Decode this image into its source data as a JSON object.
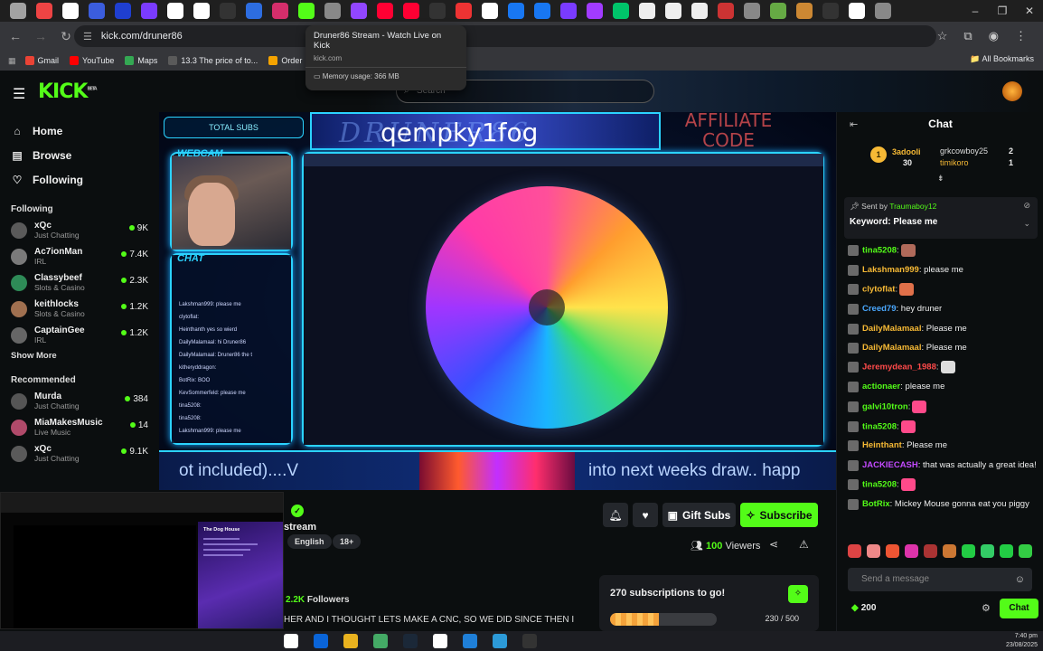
{
  "browser": {
    "tab_icon_colors": [
      "#a2a2a2",
      "#e44",
      "#fff",
      "#3b5ddd",
      "#1f3fd0",
      "#7a3bff",
      "#fff",
      "#fff",
      "#333",
      "#2d6de0",
      "#d42e6b",
      "#53fc18",
      "#888",
      "#9146ff",
      "#f03",
      "#f03",
      "#333",
      "#e33",
      "#fff",
      "#1877f2",
      "#1877f2",
      "#7a3bff",
      "#a23bff",
      "#00c46a",
      "#eee",
      "#eee",
      "#eee",
      "#c33",
      "#888",
      "#6a4",
      "#c83",
      "#333",
      "#fff",
      "#888"
    ],
    "url": "kick.com/druner86",
    "window_controls": [
      "–",
      "❐",
      "✕"
    ]
  },
  "bookmarks": [
    {
      "label": "Gmail",
      "color": "#ea4335"
    },
    {
      "label": "YouTube",
      "color": "#ff0000"
    },
    {
      "label": "Maps",
      "color": "#34a853"
    },
    {
      "label": "13.3 The price of to...",
      "color": "#5a5a5a"
    },
    {
      "label": "Order",
      "color": "#f4a300"
    }
  ],
  "bookmarks_all": "All Bookmarks",
  "tooltip": {
    "title": "Druner86 Stream - Watch Live on Kick",
    "domain": "kick.com",
    "memory": "Memory usage: 366 MB"
  },
  "kick": {
    "logo": "KICK",
    "logo_badge": "BETA",
    "search_placeholder": "Search"
  },
  "sidebar": {
    "nav": [
      {
        "label": "Home",
        "icon": "home-icon",
        "glyph": "⌂"
      },
      {
        "label": "Browse",
        "icon": "browse-icon",
        "glyph": "▤"
      },
      {
        "label": "Following",
        "icon": "heart-icon",
        "glyph": "♡"
      }
    ],
    "following_title": "Following",
    "following": [
      {
        "name": "xQc",
        "category": "Just Chatting",
        "viewers": "9K",
        "color": "#5a5a5a"
      },
      {
        "name": "Ac7ionMan",
        "category": "IRL",
        "viewers": "7.4K",
        "color": "#7a7a7a"
      },
      {
        "name": "Classybeef",
        "category": "Slots & Casino",
        "viewers": "2.3K",
        "color": "#2e8b57"
      },
      {
        "name": "keithlocks",
        "category": "Slots & Casino",
        "viewers": "1.2K",
        "color": "#a07050"
      },
      {
        "name": "CaptainGee",
        "category": "IRL",
        "viewers": "1.2K",
        "color": "#666"
      }
    ],
    "show_more": "Show More",
    "recommended_title": "Recommended",
    "recommended": [
      {
        "name": "Murda",
        "category": "Just Chatting",
        "viewers": "384",
        "color": "#555"
      },
      {
        "name": "MiaMakesMusic",
        "category": "Live Music",
        "viewers": "14",
        "color": "#b04a6a"
      },
      {
        "name": "xQc",
        "category": "Just Chatting",
        "viewers": "9.1K",
        "color": "#5a5a5a"
      }
    ]
  },
  "stream": {
    "overlay_title": "qempky1fog",
    "overlay_ghost_title": "DRUNER86",
    "affiliate_text": "AFFILIATE CODE",
    "total_subs": "TOTAL SUBS",
    "webcam_label": "WEBCAM",
    "chat_label": "CHAT",
    "ticker_left": "ot included)....V",
    "ticker_right": "into next weeks draw.. happ",
    "overlay_chat": [
      "Lakshman999: please me",
      "clytoflat:",
      "Heinthanth yes so wierd",
      "DailyMalamaal: hi Druner86",
      "DailyMalamaal: Druner86 the t",
      "kitheryddragon:",
      "BotRix: BOO",
      "KevSommerfeld: please me",
      "tina5208:",
      "tina5208:",
      "Lakshman999: please me"
    ],
    "name_partial": "stream",
    "tags": [
      "English",
      "18+"
    ],
    "gift_subs": "Gift Subs",
    "subscribe": "Subscribe",
    "viewers_count": "100",
    "viewers_label": "Viewers",
    "followers_count": "2.2K",
    "followers_label": "Followers",
    "bio": "HER AND I THOUGHT LETS MAKE A CNC, SO WE DID SINCE THEN I",
    "sub_goal": {
      "title": "270 subscriptions to go!",
      "progress": "230 / 500",
      "fraction": 0.46
    }
  },
  "pip": {
    "card_title": "The Dog House"
  },
  "chat": {
    "title": "Chat",
    "leaderboard": [
      {
        "name": "3adooli",
        "value": "30"
      },
      {
        "name": "grkcowboy25",
        "value": "2"
      },
      {
        "name": "timikoro",
        "value": "1"
      }
    ],
    "medal": "1",
    "giveaway_sent_by": "Sent by",
    "giveaway_sender": "Traumaboy12",
    "giveaway_keyword": "Keyword: Please me",
    "messages": [
      {
        "user": "tina5208",
        "text": "",
        "color": "#53fc18",
        "emote": "#b06a5a"
      },
      {
        "user": "Lakshman999",
        "text": " please me",
        "color": "#f6b935",
        "emote": ""
      },
      {
        "user": "clytoflat",
        "text": "",
        "color": "#f6b935",
        "emote": "#e0704a"
      },
      {
        "user": "Creed79",
        "text": " hey druner",
        "color": "#4aa8ff",
        "emote": ""
      },
      {
        "user": "DailyMalamaal",
        "text": " Please me",
        "color": "#f6b935",
        "emote": ""
      },
      {
        "user": "DailyMalamaal",
        "text": " Please me",
        "color": "#f6b935",
        "emote": ""
      },
      {
        "user": "Jeremydean_1988",
        "text": "",
        "color": "#ff4a4a",
        "emote": "#ddd"
      },
      {
        "user": "actionaer",
        "text": " please me",
        "color": "#53fc18",
        "emote": ""
      },
      {
        "user": "galvi10tron",
        "text": "",
        "color": "#53fc18",
        "emote": "#ff4a8a"
      },
      {
        "user": "tina5208",
        "text": "",
        "color": "#53fc18",
        "emote": "#ff4a8a"
      },
      {
        "user": "Heinthant",
        "text": " Please me",
        "color": "#f6b935",
        "emote": ""
      },
      {
        "user": "JACKIECASH",
        "text": " that was actually a great idea!",
        "color": "#c34aff",
        "emote": ""
      },
      {
        "user": "tina5208",
        "text": "",
        "color": "#53fc18",
        "emote": "#ff4a8a"
      },
      {
        "user": "BotRix",
        "text": " Mickey Mouse gonna eat you piggy",
        "color": "#53fc18",
        "emote": ""
      }
    ],
    "emote_colors": [
      "#d44",
      "#e88",
      "#e53",
      "#d3a",
      "#a33",
      "#c73",
      "#2c4",
      "#3c6",
      "#2c4",
      "#3c4"
    ],
    "send_placeholder": "Send a message",
    "points": "200",
    "chat_button": "Chat"
  },
  "taskbar": {
    "time": "7:40 pm",
    "date": "23/08/2025",
    "app_colors": [
      "#fff",
      "#0a64d8",
      "#e9b21f",
      "#4a6",
      "#1b2838",
      "#fff",
      "#1f7fd8",
      "#2c9ad8",
      "#333"
    ]
  }
}
